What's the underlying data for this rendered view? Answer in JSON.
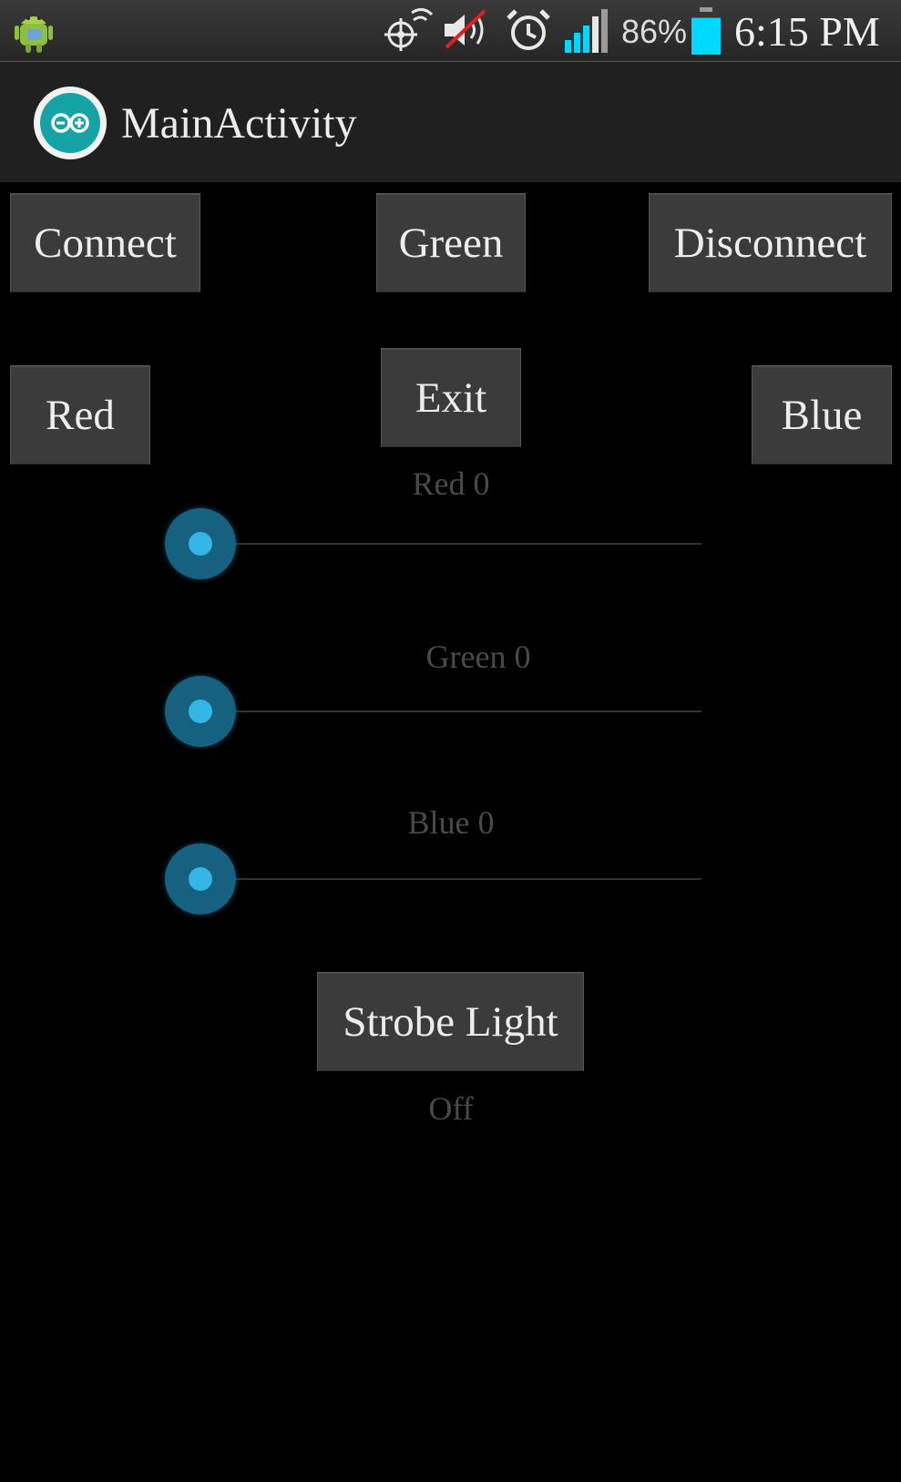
{
  "status_bar": {
    "notification_icon": "android-robot-icon",
    "icons": [
      "gps-icon",
      "mute-icon",
      "alarm-icon",
      "signal-icon",
      "battery-icon"
    ],
    "battery_percent": "86%",
    "battery_level": 0.86,
    "time": "6:15 PM",
    "accent_color": "#00d8ff"
  },
  "action_bar": {
    "app_icon": "arduino-icon",
    "title": "MainActivity"
  },
  "buttons": {
    "connect": "Connect",
    "green": "Green",
    "disconnect": "Disconnect",
    "red": "Red",
    "exit": "Exit",
    "blue": "Blue",
    "strobe": "Strobe Light"
  },
  "sliders": [
    {
      "label": "Red 0",
      "value": 0
    },
    {
      "label": "Green 0",
      "value": 0
    },
    {
      "label": "Blue 0",
      "value": 0
    }
  ],
  "strobe_status": "Off",
  "colors": {
    "background": "#000000",
    "button": "#3b3b3b",
    "slider_thumb": "#33b5e5"
  }
}
